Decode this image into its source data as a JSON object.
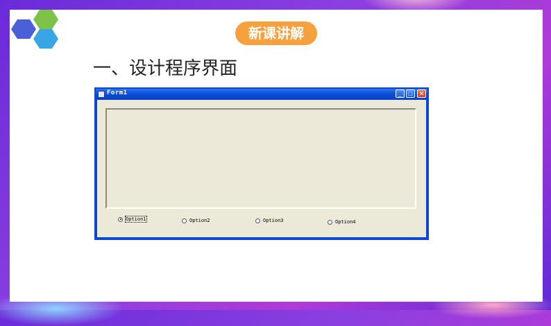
{
  "slide": {
    "badge": "新课讲解",
    "heading": "一、设计程序界面"
  },
  "window": {
    "title": "Form1",
    "options": [
      {
        "label": "Option1",
        "checked": true
      },
      {
        "label": "Option2",
        "checked": false
      },
      {
        "label": "Option3",
        "checked": false
      },
      {
        "label": "Option4",
        "checked": false
      }
    ]
  },
  "colors": {
    "badge": "#f6a13d",
    "titlebar": "#0a48d4",
    "client": "#ece9d8"
  }
}
